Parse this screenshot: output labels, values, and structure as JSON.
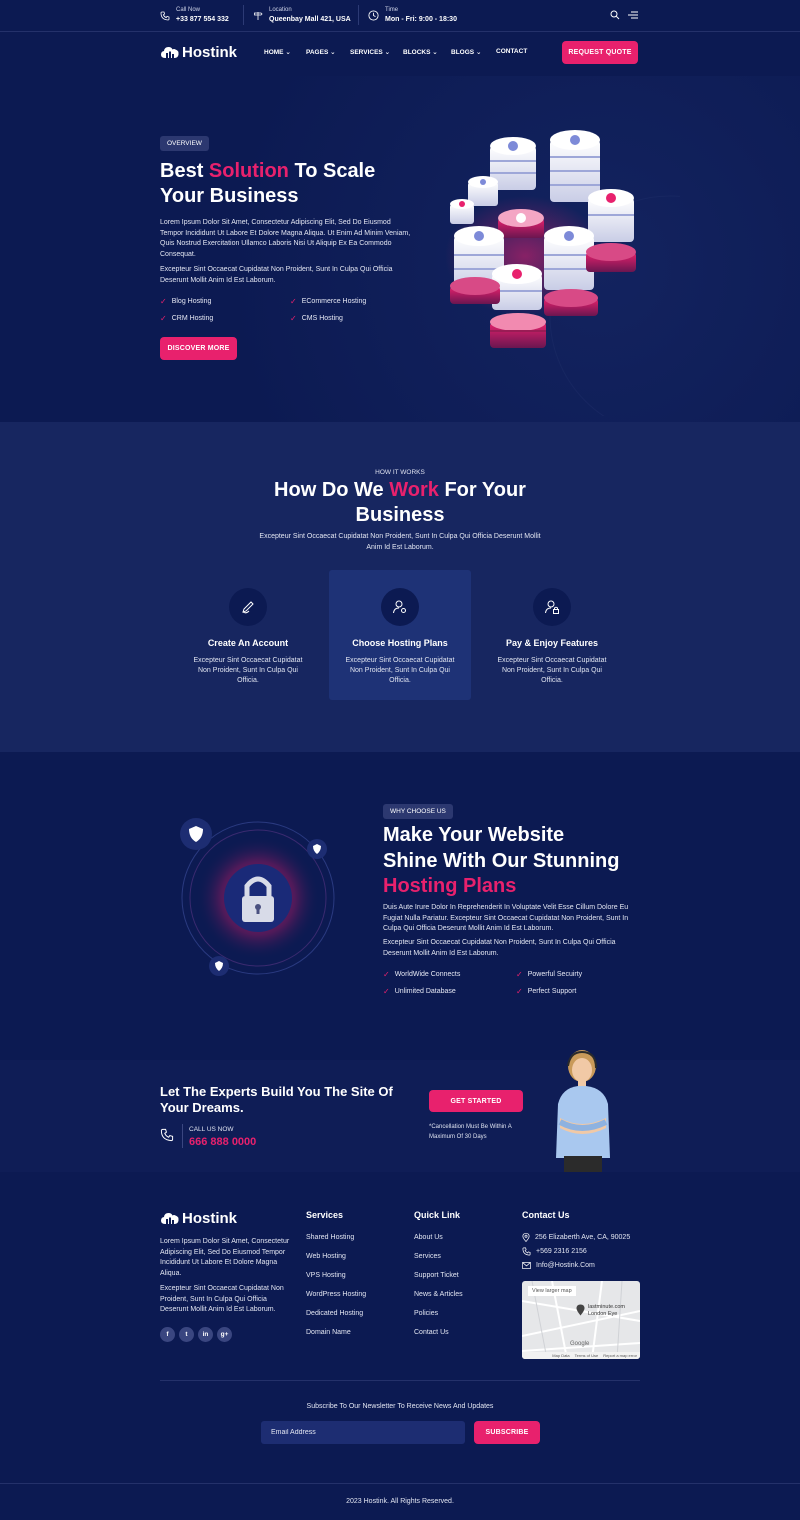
{
  "colors": {
    "accent": "#e8216d",
    "bg": "#0c1a52",
    "section_alt": "#172660"
  },
  "topbar": {
    "call": {
      "label": "Call Now",
      "value": "+33 877 554 332"
    },
    "location": {
      "label": "Location",
      "value": "Queenbay Mall 421, USA"
    },
    "time": {
      "label": "Time",
      "value": "Mon - Fri: 9:00 - 18:30"
    }
  },
  "brand": {
    "name": "Hostink"
  },
  "nav": {
    "items": [
      "HOME",
      "PAGES",
      "SERVICES",
      "BLOCKS",
      "BLOGS",
      "CONTACT"
    ],
    "cta": "REQUEST QUOTE"
  },
  "hero": {
    "badge": "OVERVIEW",
    "title_pre": "Best",
    "title_accent": "Solution",
    "title_post1": "To Scale",
    "title_post2": "Your Business",
    "para1": "Lorem Ipsum Dolor Sit Amet, Consectetur Adipiscing Elit, Sed Do Eiusmod Tempor Incididunt Ut Labore Et Dolore Magna Aliqua. Ut Enim Ad Minim Veniam, Quis Nostrud Exercitation Ullamco Laboris Nisi Ut Aliquip Ex Ea Commodo Consequat.",
    "para2": "Excepteur Sint Occaecat Cupidatat Non Proident, Sunt In Culpa Qui Officia Deserunt Mollit Anim Id Est Laborum.",
    "features": [
      "Blog Hosting",
      "ECommerce Hosting",
      "CRM Hosting",
      "CMS Hosting"
    ],
    "button": "DISCOVER MORE"
  },
  "how": {
    "tag": "HOW IT WORKS",
    "title_pre": "How Do We",
    "title_accent": "Work",
    "title_post": "For Your",
    "title_line2": "Business",
    "desc": "Excepteur Sint Occaecat Cupidatat Non Proident, Sunt In Culpa Qui Officia Deserunt Mollit Anim Id Est Laborum.",
    "steps": [
      {
        "title": "Create An Account",
        "desc": "Excepteur Sint Occaecat Cupidatat Non Proident, Sunt In Culpa Qui Officia."
      },
      {
        "title": "Choose Hosting Plans",
        "desc": "Excepteur Sint Occaecat Cupidatat Non Proident, Sunt In Culpa Qui Officia."
      },
      {
        "title": "Pay & Enjoy Features",
        "desc": "Excepteur Sint Occaecat Cupidatat Non Proident, Sunt In Culpa Qui Officia."
      }
    ]
  },
  "why": {
    "badge": "WHY CHOOSE US",
    "title_line1": "Make Your Website",
    "title_line2": "Shine With Our Stunning",
    "title_accent": "Hosting Plans",
    "para1": "Duis Aute Irure Dolor In Reprehenderit In Voluptate Velit Esse Cillum Dolore Eu Fugiat Nulla Pariatur. Excepteur Sint Occaecat Cupidatat Non Proident, Sunt In Culpa Qui Officia Deserunt Mollit Anim Id Est Laborum.",
    "para2": "Excepteur Sint Occaecat Cupidatat Non Proident, Sunt In Culpa Qui Officia Deserunt Mollit Anim Id Est Laborum.",
    "features": [
      "WorldWide Connects",
      "Powerful Secuirty",
      "Unlimited Database",
      "Perfect Support"
    ]
  },
  "cta": {
    "title": "Let The Experts Build You The Site Of Your Dreams.",
    "call_label": "CALL US NOW",
    "phone": "666 888 0000",
    "button": "GET STARTED",
    "note": "*Cancellation Must Be Within A Maximum Of 30 Days"
  },
  "footer": {
    "about1": "Lorem Ipsum Dolor Sit Amet, Consectetur Adipiscing Elit, Sed Do Eiusmod Tempor Incididunt Ut Labore Et Dolore Magna Aliqua.",
    "about2": "Excepteur Sint Occaecat Cupidatat Non Proident, Sunt In Culpa Qui Officia Deserunt Mollit Anim Id Est Laborum.",
    "social": [
      "f",
      "t",
      "in",
      "g+"
    ],
    "services_title": "Services",
    "services": [
      "Shared Hosting",
      "Web Hosting",
      "VPS Hosting",
      "WordPress Hosting",
      "Dedicated Hosting",
      "Domain Name"
    ],
    "quick_title": "Quick Link",
    "quick": [
      "About Us",
      "Services",
      "Support Ticket",
      "News & Articles",
      "Policies",
      "Contact Us"
    ],
    "contact_title": "Contact Us",
    "address": "256 Elizaberth Ave, CA, 90025",
    "phone": "+569 2316 2156",
    "email": "Info@Hostink.Com",
    "map_link": "View larger map",
    "map_place1": "lastminute.com",
    "map_place2": "London Eye",
    "map_footer": [
      "Map Data",
      "Terms of Use",
      "Report a map error"
    ],
    "map_brand": "Google",
    "newsletter_title": "Subscribe To Our Newsletter To Receive News And Updates",
    "email_placeholder": "Email Address",
    "subscribe": "SUBSCRIBE",
    "copyright": "2023 Hostink. All Rights Reserved."
  }
}
